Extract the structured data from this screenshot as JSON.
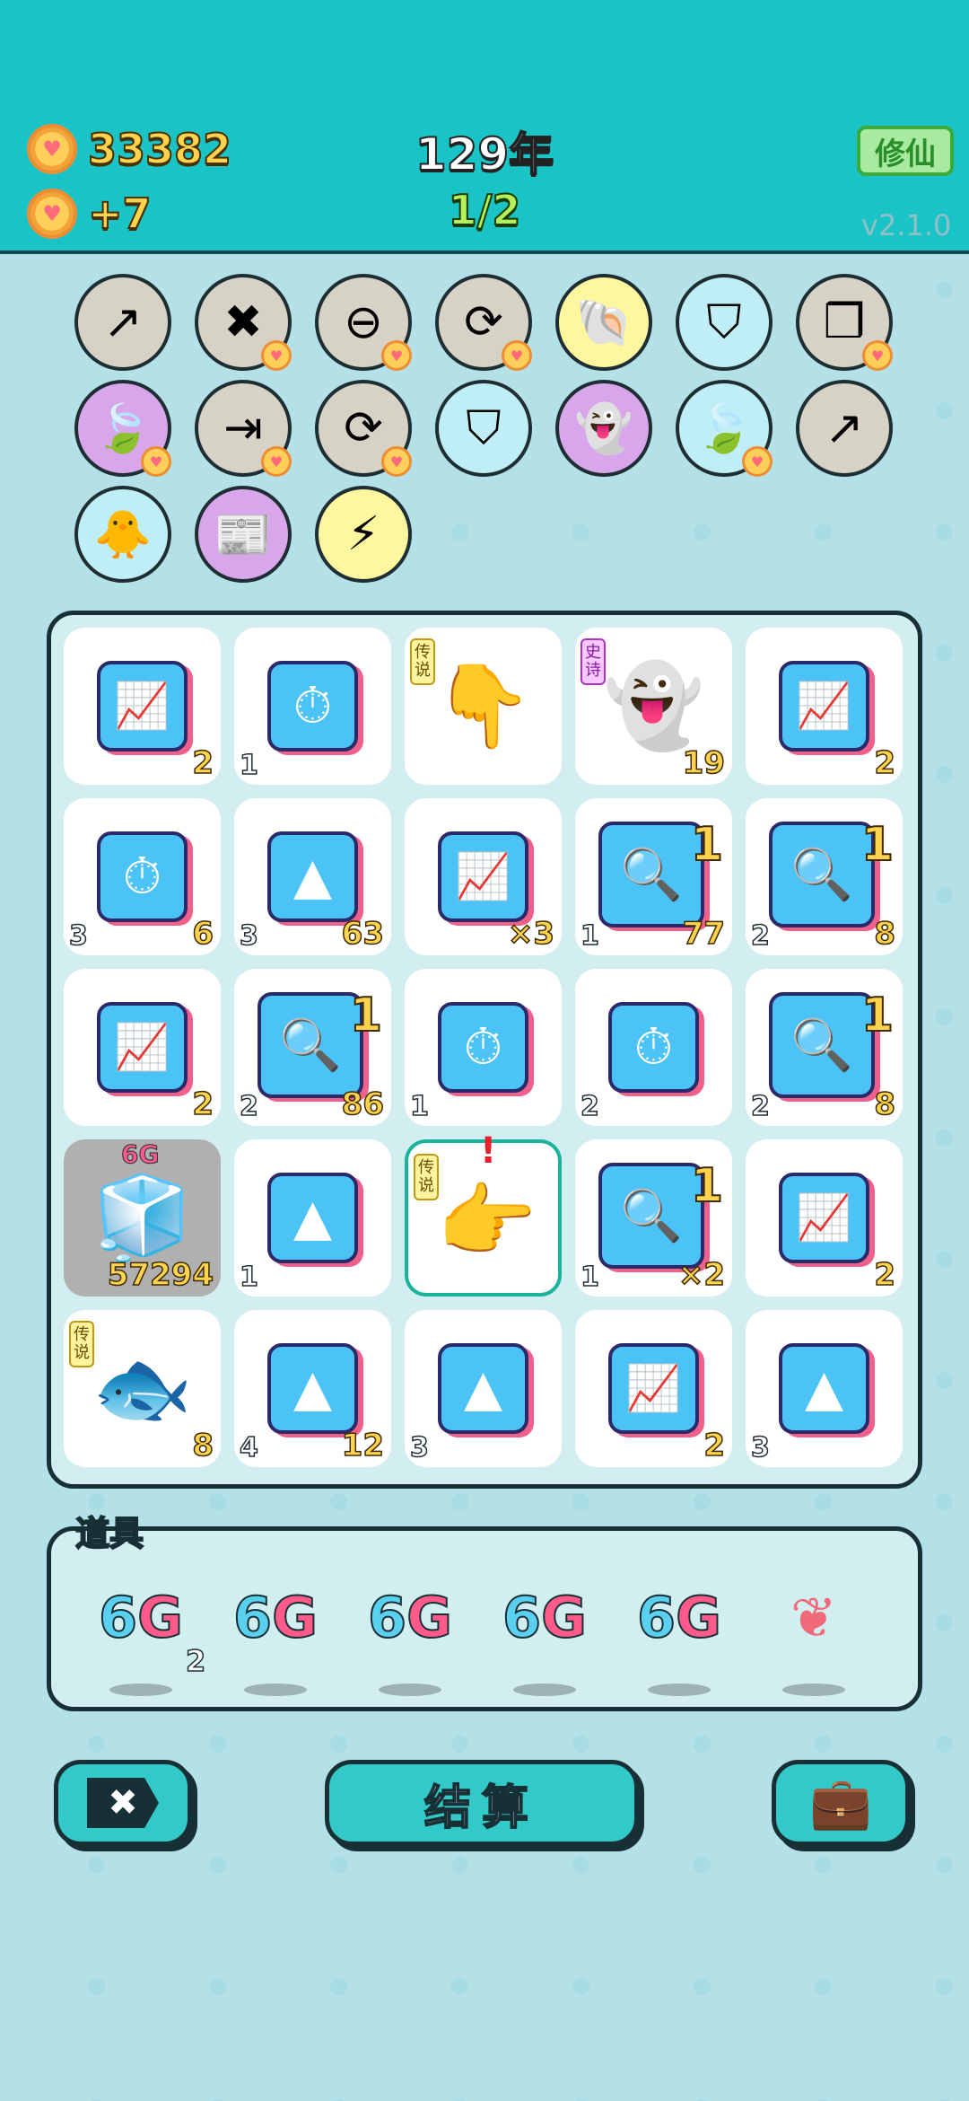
{
  "header": {
    "coins": "33382",
    "coin_rate": "+7",
    "year": "129年",
    "progress": "1/2",
    "mode_button": "修仙",
    "version": "v2.1.0"
  },
  "buffs": [
    {
      "icon": "arrow-up-card-icon",
      "bg": "#d6d2c6",
      "glyph": "↗",
      "coin": false
    },
    {
      "icon": "delete-tag-icon",
      "bg": "#d6d2c6",
      "glyph": "✖",
      "coin": true
    },
    {
      "icon": "minus-circle-icon",
      "bg": "#d6d2c6",
      "glyph": "⊖",
      "coin": true
    },
    {
      "icon": "refresh-icon",
      "bg": "#d6d2c6",
      "glyph": "⟳",
      "coin": true
    },
    {
      "icon": "shell-icon",
      "bg": "#fff6a0",
      "glyph": "🐚",
      "coin": false
    },
    {
      "icon": "skirt-icon",
      "bg": "#bfeef6",
      "glyph": "⛉",
      "coin": false
    },
    {
      "icon": "cubes-icon",
      "bg": "#d6d2c6",
      "glyph": "❒",
      "coin": true
    },
    {
      "icon": "leaf-icon",
      "bg": "#d8a6ea",
      "glyph": "🍃",
      "coin": true
    },
    {
      "icon": "skip-icon",
      "bg": "#d6d2c6",
      "glyph": "⇥",
      "coin": true
    },
    {
      "icon": "refresh-icon",
      "bg": "#d6d2c6",
      "glyph": "⟳",
      "coin": true
    },
    {
      "icon": "skirt-icon",
      "bg": "#bfeef6",
      "glyph": "⛉",
      "coin": false
    },
    {
      "icon": "ghost-light-icon",
      "bg": "#d8a6ea",
      "glyph": "👻",
      "coin": false
    },
    {
      "icon": "leaf-icon",
      "bg": "#bfeef6",
      "glyph": "🍃",
      "coin": true
    },
    {
      "icon": "arrow-up-card-icon",
      "bg": "#d6d2c6",
      "glyph": "↗",
      "coin": false
    },
    {
      "icon": "chick-egg-icon",
      "bg": "#bfeef6",
      "glyph": "🐥",
      "coin": false
    },
    {
      "icon": "time-magazine-icon",
      "bg": "#d8a6ea",
      "glyph": "📰",
      "coin": false
    },
    {
      "icon": "lightning-icon",
      "bg": "#fff6a0",
      "glyph": "⚡",
      "coin": false
    }
  ],
  "board": [
    {
      "type": "graph",
      "right": "2",
      "left": ""
    },
    {
      "type": "stopwatch",
      "right": "",
      "left": "1"
    },
    {
      "type": "finger-down",
      "right": "",
      "left": "",
      "badge": "传说"
    },
    {
      "type": "ghost",
      "right": "19",
      "left": "",
      "badge": "史诗"
    },
    {
      "type": "graph",
      "right": "2",
      "left": ""
    },
    {
      "type": "stopwatch",
      "right": "6",
      "left": "3"
    },
    {
      "type": "gold",
      "right": "63",
      "left": "3"
    },
    {
      "type": "graph",
      "right": "×3",
      "left": ""
    },
    {
      "type": "magnifier",
      "right": "77",
      "left": "1",
      "sup": "1"
    },
    {
      "type": "magnifier",
      "right": "8",
      "left": "2",
      "sup": "1"
    },
    {
      "type": "graph",
      "right": "2",
      "left": ""
    },
    {
      "type": "magnifier",
      "right": "86",
      "left": "2",
      "sup": "1"
    },
    {
      "type": "stopwatch",
      "right": "",
      "left": "1"
    },
    {
      "type": "stopwatch",
      "right": "",
      "left": "2"
    },
    {
      "type": "magnifier",
      "right": "8",
      "left": "2",
      "sup": "1"
    },
    {
      "type": "fridge",
      "right": "57294",
      "left": "",
      "tag": "6G",
      "gray": true
    },
    {
      "type": "gold",
      "right": "",
      "left": "1"
    },
    {
      "type": "finger-point",
      "right": "",
      "left": "",
      "badge": "传说",
      "selected": true,
      "alert": "!"
    },
    {
      "type": "magnifier",
      "right": "×2",
      "left": "1",
      "sup": "1"
    },
    {
      "type": "graph",
      "right": "2",
      "left": ""
    },
    {
      "type": "koi",
      "right": "8",
      "left": "",
      "badge": "传说"
    },
    {
      "type": "gold",
      "right": "12",
      "left": "4"
    },
    {
      "type": "gold",
      "right": "",
      "left": "3"
    },
    {
      "type": "graph",
      "right": "2",
      "left": ""
    },
    {
      "type": "gold",
      "right": "",
      "left": "3"
    }
  ],
  "items": {
    "title": "道具",
    "list": [
      {
        "label_a": "6",
        "label_b": "G",
        "count": "2",
        "icon": "6g-icon"
      },
      {
        "label_a": "6",
        "label_b": "G",
        "count": "",
        "icon": "6g-icon"
      },
      {
        "label_a": "6",
        "label_b": "G",
        "count": "",
        "icon": "6g-icon"
      },
      {
        "label_a": "6",
        "label_b": "G",
        "count": "",
        "icon": "6g-icon"
      },
      {
        "label_a": "6",
        "label_b": "G",
        "count": "",
        "icon": "6g-icon"
      },
      {
        "label_a": "",
        "label_b": "",
        "count": "",
        "icon": "liver-icon"
      }
    ]
  },
  "buttons": {
    "settle": "结算"
  }
}
